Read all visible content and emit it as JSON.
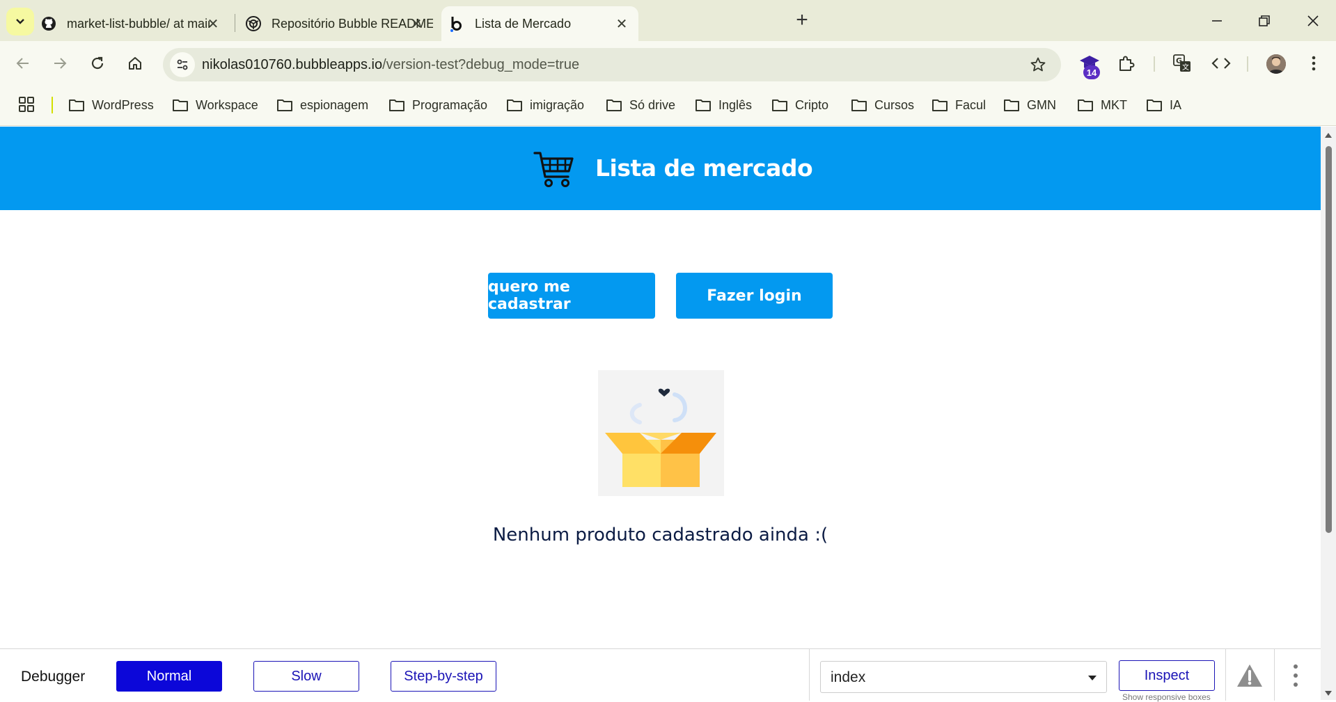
{
  "browser": {
    "tabs": [
      {
        "title": "market-list-bubble/ at main · ni",
        "icon": "github-icon",
        "active": false
      },
      {
        "title": "Repositório Bubble README",
        "icon": "openai-icon",
        "active": false
      },
      {
        "title": "Lista de Mercado",
        "icon": "bubble-icon",
        "active": true
      }
    ],
    "url_host": "nikolas010760.bubbleapps.io",
    "url_path": "/version-test?debug_mode=true",
    "extension_badge": "14",
    "bookmarks": [
      "WordPress",
      "Workspace",
      "espionagem",
      "Programação",
      "imigração",
      "Só drive",
      "Inglês",
      "Cripto",
      "Cursos",
      "Facul",
      "GMN",
      "MKT",
      "IA"
    ]
  },
  "page": {
    "header_title": "Lista de mercado",
    "signup_label": "quero me cadastrar",
    "login_label": "Fazer login",
    "empty_message": "Nenhum produto cadastrado ainda :("
  },
  "debugger": {
    "label": "Debugger",
    "modes": [
      "Normal",
      "Slow",
      "Step-by-step"
    ],
    "active_mode": "Normal",
    "page_select": "index",
    "inspect_label": "Inspect",
    "show_boxes_label": "Show responsive boxes"
  },
  "colors": {
    "brand_blue": "#0399f0",
    "debugger_blue": "#0c07d9",
    "chrome_bg": "#e9ebd8"
  }
}
